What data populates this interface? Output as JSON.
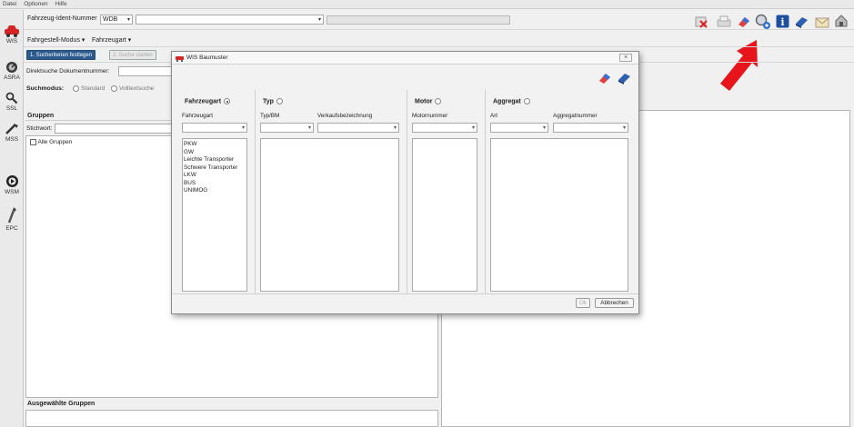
{
  "menu": [
    "Datei",
    "Optionen",
    "Hilfe"
  ],
  "sidebar": [
    {
      "label": "WIS",
      "icon": "car-icon"
    },
    {
      "label": "ASRA",
      "icon": "asra-icon"
    },
    {
      "label": "SSL",
      "icon": "wrench-icon"
    },
    {
      "label": "MSS",
      "icon": "tools-icon"
    },
    {
      "label": "WSM",
      "icon": "wsm-icon"
    },
    {
      "label": "EPC",
      "icon": "epc-icon"
    }
  ],
  "header": {
    "fin_label": "Fahrzeug-Ident-Nummer",
    "fin_prefix": "WDB",
    "mode_label": "Fahrgestell-Modus",
    "type_label": "Fahrzeugart"
  },
  "toolbar": {
    "icons": [
      "cancel-icon",
      "print-icon",
      "eraser-icon",
      "search-baumuster-icon",
      "info-icon",
      "books-icon",
      "mail-icon",
      "home-icon"
    ]
  },
  "steps": {
    "step1": "1. Sucheriterien festlegen",
    "step2": "2. Suche starten"
  },
  "direct_search_label": "Direktsuche Dokumentnummer:",
  "search_mode": {
    "label": "Suchmodus:",
    "opt1": "Standard",
    "opt2": "Volltextsuche"
  },
  "groups": {
    "title": "Gruppen",
    "keyword_label": "Stichwort:",
    "all_groups": "Alle Gruppen",
    "selected_title": "Ausgewählte Gruppen"
  },
  "dialog": {
    "title": "WIS Baumuster",
    "col1": {
      "title": "Fahrzeugart",
      "field": "Fahrzeugart",
      "items": [
        "PKW",
        "GW",
        "Leichte Transporter",
        "Schwere Transporter",
        "LKW",
        "BUS",
        "UNIMOG"
      ]
    },
    "col2": {
      "title": "Typ",
      "field1": "Typ/BM",
      "field2": "Verkaufsbezeichnung"
    },
    "col3": {
      "title": "Motor",
      "field": "Motornummer"
    },
    "col4": {
      "title": "Aggregat",
      "field1": "Art",
      "field2": "Aggregatnummer"
    },
    "ok": "Ok",
    "cancel": "Abbrechen"
  },
  "colors": {
    "accent": "#1f5fa8",
    "arrow": "#e8141b",
    "step_active": "#2b5b8e"
  }
}
